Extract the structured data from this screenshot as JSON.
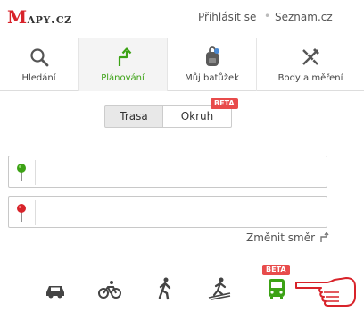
{
  "header": {
    "logo_first": "M",
    "logo_rest": "apy.cz",
    "login": "Přihlásit se",
    "separator": "•",
    "seznam": "Seznam.cz"
  },
  "tabs": [
    {
      "label": "Hledání",
      "icon": "search-icon"
    },
    {
      "label": "Plánování",
      "icon": "route-planning-icon",
      "active": true
    },
    {
      "label": "Můj batůžek",
      "icon": "backpack-icon"
    },
    {
      "label": "Body a měření",
      "icon": "measure-tools-icon"
    }
  ],
  "route_type": {
    "trasa": "Trasa",
    "okruh": "Okruh",
    "beta": "BETA"
  },
  "inputs": {
    "start_value": "",
    "end_value": ""
  },
  "change_direction": "Změnit směr",
  "transport": {
    "beta": "BETA",
    "modes": [
      "car-icon",
      "bicycle-icon",
      "walking-icon",
      "skiing-icon",
      "bus-icon"
    ],
    "active_color": "#3ca215"
  },
  "colors": {
    "accent_green": "#3ca215",
    "brand_red": "#d8232a",
    "beta_red": "#e84b4b"
  }
}
